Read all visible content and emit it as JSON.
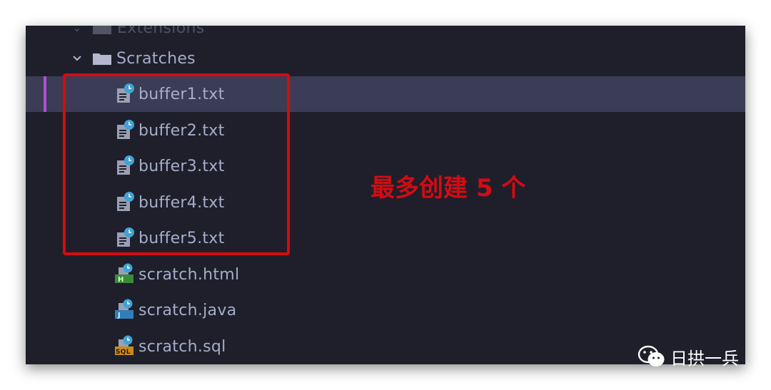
{
  "tree": {
    "extensions_label": "Extensions",
    "scratches_label": "Scratches",
    "files": [
      {
        "name": "buffer1.txt",
        "icon": "text-scratch-icon"
      },
      {
        "name": "buffer2.txt",
        "icon": "text-scratch-icon"
      },
      {
        "name": "buffer3.txt",
        "icon": "text-scratch-icon"
      },
      {
        "name": "buffer4.txt",
        "icon": "text-scratch-icon"
      },
      {
        "name": "buffer5.txt",
        "icon": "text-scratch-icon"
      },
      {
        "name": "scratch.html",
        "icon": "html-scratch-icon"
      },
      {
        "name": "scratch.java",
        "icon": "java-scratch-icon"
      },
      {
        "name": "scratch.sql",
        "icon": "sql-scratch-icon"
      }
    ],
    "selected_index": 0
  },
  "annotation": {
    "text": "最多创建 5 个",
    "color": "#d40b12"
  },
  "icon_badges": {
    "html": "H",
    "java": "J",
    "sql": "SQL"
  },
  "watermark": {
    "text": "日拱一兵"
  },
  "colors": {
    "background": "#1e1f2b",
    "selected_row": "#3a3d55",
    "selection_marker": "#b04fd6",
    "text": "#a7adc9",
    "annotation_red": "#d40b12"
  }
}
